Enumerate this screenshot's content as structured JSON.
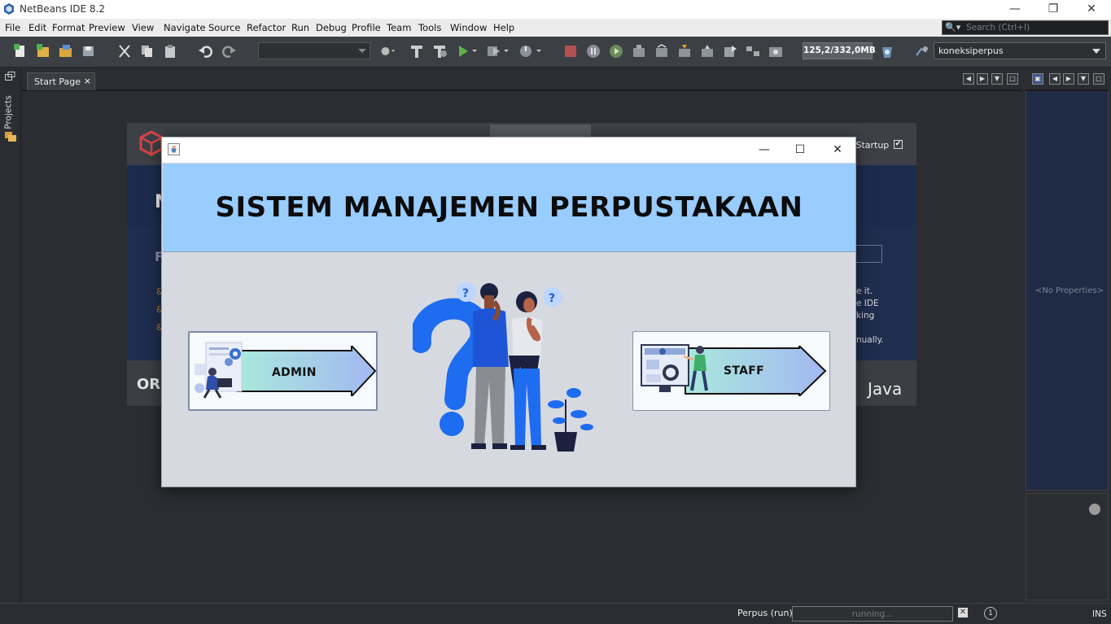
{
  "window": {
    "title": "NetBeans IDE 8.2",
    "controls": {
      "minimize": "—",
      "maximize": "❐",
      "close": "✕"
    }
  },
  "menu": [
    "File",
    "Edit",
    "Format",
    "Preview",
    "View",
    "Navigate",
    "Source",
    "Refactor",
    "Run",
    "Debug",
    "Profile",
    "Team",
    "Tools",
    "Window",
    "Help"
  ],
  "search": {
    "placeholder": "Search (Ctrl+I)"
  },
  "toolbar": {
    "memory": "125,2/332,0MB",
    "connection": "koneksiperpus"
  },
  "leftbar": {
    "projects": "Projects"
  },
  "editor": {
    "tab_label": "Start Page",
    "tab_close": "×"
  },
  "startpage": {
    "startup_label": "n Startup",
    "startup_checked": "✔",
    "right_text": [
      "e it.",
      "e IDE",
      "king",
      "nually."
    ],
    "letters": [
      "N",
      "F",
      "&",
      "&",
      "&"
    ],
    "footer_left": "OR",
    "footer_right": "Java"
  },
  "properties": {
    "empty": "<No Properties>"
  },
  "status": {
    "process": "Perpus (run)",
    "progress_text": "running...",
    "stop": "✕",
    "notification": "1",
    "mode": "INS"
  },
  "dialog": {
    "heading": "SISTEM MANAJEMEN PERPUSTAKAAN",
    "controls": {
      "minimize": "—",
      "maximize": "☐",
      "close": "✕"
    },
    "admin_label": "ADMIN",
    "staff_label": "STAFF",
    "question_mark": "?"
  },
  "colors": {
    "header_bg": "#99ccff",
    "dialog_bg": "#d6d9e0",
    "ide_bg": "#2b2d32",
    "arrow_gradient_start": "#a9e9dc",
    "arrow_gradient_end": "#a3b8f2",
    "figure_blue": "#1e6cf0"
  }
}
